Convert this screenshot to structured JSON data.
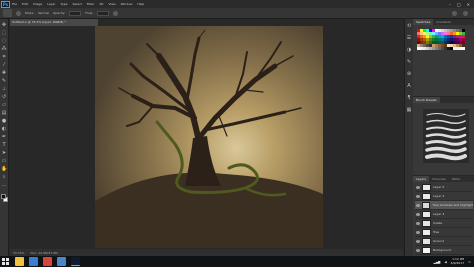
{
  "app": {
    "logo_text": "Ps",
    "menus": [
      "File",
      "Edit",
      "Image",
      "Layer",
      "Type",
      "Select",
      "Filter",
      "3D",
      "View",
      "Window",
      "Help"
    ],
    "window_controls": [
      "–",
      "□",
      "✕"
    ]
  },
  "options_bar": {
    "mode_label": "Mode:",
    "mode_value": "Normal",
    "opacity_label": "Opacity:",
    "opacity_value": "100%",
    "flow_label": "Flow:",
    "flow_value": "100%"
  },
  "document": {
    "tab_title": "Untitled-1 @ 33.3% (layer, RGB/8) *",
    "zoom": "33.33%",
    "doc_size": "Doc: 24.9M/47.8M"
  },
  "tools": [
    {
      "icon": "move-tool-icon",
      "glyph": "✥"
    },
    {
      "icon": "marquee-tool-icon",
      "glyph": "⬚"
    },
    {
      "icon": "lasso-tool-icon",
      "glyph": "◌"
    },
    {
      "icon": "quick-select-tool-icon",
      "glyph": "⁂"
    },
    {
      "icon": "crop-tool-icon",
      "glyph": "⌗"
    },
    {
      "icon": "eyedropper-tool-icon",
      "glyph": "⁄"
    },
    {
      "icon": "healing-tool-icon",
      "glyph": "✚"
    },
    {
      "icon": "brush-tool-icon",
      "glyph": "✎"
    },
    {
      "icon": "clone-stamp-tool-icon",
      "glyph": "⊥"
    },
    {
      "icon": "history-brush-tool-icon",
      "glyph": "↺"
    },
    {
      "icon": "eraser-tool-icon",
      "glyph": "▱"
    },
    {
      "icon": "gradient-tool-icon",
      "glyph": "▤"
    },
    {
      "icon": "blur-tool-icon",
      "glyph": "●"
    },
    {
      "icon": "dodge-tool-icon",
      "glyph": "◐"
    },
    {
      "icon": "pen-tool-icon",
      "glyph": "✒"
    },
    {
      "icon": "type-tool-icon",
      "glyph": "T"
    },
    {
      "icon": "path-select-tool-icon",
      "glyph": "➤"
    },
    {
      "icon": "shape-tool-icon",
      "glyph": "▭"
    },
    {
      "icon": "hand-tool-icon",
      "glyph": "✋"
    },
    {
      "icon": "zoom-tool-icon",
      "glyph": "⌕"
    },
    {
      "icon": "more-tools-icon",
      "glyph": "…"
    }
  ],
  "colors": {
    "foreground": "#121212",
    "background": "#ffffff",
    "accent": "#31a8ff"
  },
  "right_strip_icons": [
    {
      "icon": "history-panel-icon",
      "glyph": "⟲"
    },
    {
      "icon": "properties-panel-icon",
      "glyph": "☰"
    },
    {
      "icon": "adjustments-panel-icon",
      "glyph": "◑"
    },
    {
      "icon": "brush-settings-icon",
      "glyph": "✎"
    },
    {
      "icon": "clone-source-icon",
      "glyph": "⊕"
    },
    {
      "icon": "character-panel-icon",
      "glyph": "A"
    },
    {
      "icon": "paragraph-panel-icon",
      "glyph": "¶"
    },
    {
      "icon": "libraries-panel-icon",
      "glyph": "▦"
    }
  ],
  "panels": {
    "color_tabs": [
      "Swatches",
      "Gradients"
    ],
    "brush_panel_label": "Brush Presets",
    "layers_tabs": [
      "Layers",
      "Channels",
      "Paths"
    ]
  },
  "swatches": [
    "#ff0000",
    "#ffff00",
    "#00ff00",
    "#00ffff",
    "#0000ff",
    "#ff00ff",
    "#ffffff",
    "#ebebeb",
    "#d6d6d6",
    "#c2c2c2",
    "#adadad",
    "#999999",
    "#858585",
    "#707070",
    "#5c5c5c",
    "#000000",
    "#ff6f6f",
    "#ffc46f",
    "#fff36f",
    "#b8ff6f",
    "#6fffb0",
    "#6ff3ff",
    "#6fb5ff",
    "#7a6fff",
    "#c66fff",
    "#ff6fe0",
    "#ff6fa2",
    "#f26522",
    "#f7941d",
    "#fff200",
    "#8dc63f",
    "#39b54a",
    "#ed1c24",
    "#f26522",
    "#f7941d",
    "#fff200",
    "#8dc63f",
    "#39b54a",
    "#00a651",
    "#00a99d",
    "#00aeef",
    "#0072bc",
    "#0054a6",
    "#2e3192",
    "#662d91",
    "#92278f",
    "#ec008c",
    "#ed145b",
    "#9e0b0f",
    "#a0410d",
    "#a36209",
    "#aba000",
    "#598527",
    "#1a7b30",
    "#007236",
    "#00746b",
    "#0076a3",
    "#004b80",
    "#003471",
    "#1b1464",
    "#440e62",
    "#630460",
    "#9e005d",
    "#9e0039",
    "#790000",
    "#7b2e00",
    "#7d4900",
    "#827b00",
    "#406618",
    "#005e20",
    "#005826",
    "#005952",
    "#005b7f",
    "#003663",
    "#002157",
    "#0d004c",
    "#32004b",
    "#4b0049",
    "#7b0046",
    "#7a0026",
    "#c7b299",
    "#998675",
    "#736357",
    "#534741",
    "#37302d",
    "#c69c6d",
    "#a67c52",
    "#8c6239",
    "#754c24",
    "#603913",
    "#ffe3c6",
    "#f5d2a6",
    "#e3b58c",
    "#b8875c",
    "#8a5a34",
    "#4a2a16",
    "#ffffff",
    "#f2f2f2",
    "#e6e6e6",
    "#cccccc",
    "#b3b3b3",
    "#999999",
    "#808080",
    "#666666",
    "#4d4d4d",
    "#333333",
    "#1a1a1a",
    "#000000",
    "#fde6e6",
    "#e6f0fd",
    "#e6fde9",
    "#fdfbe6"
  ],
  "brushes": [
    {
      "width": 1
    },
    {
      "width": 1.5
    },
    {
      "width": 2
    },
    {
      "width": 2.5
    },
    {
      "width": 3
    },
    {
      "width": 3.5
    },
    {
      "width": 4
    }
  ],
  "layers": [
    {
      "name": "Layer 5",
      "selected": false,
      "thumb": "#e9e9e9"
    },
    {
      "name": "Layer 4",
      "selected": false,
      "thumb": "#e9e9e9"
    },
    {
      "name": "Tree shadows and highlights",
      "selected": true,
      "thumb": "#d8d8d8"
    },
    {
      "name": "Layer 3",
      "selected": false,
      "thumb": "#e9e9e9"
    },
    {
      "name": "Snake",
      "selected": false,
      "thumb": "#e4e4e4"
    },
    {
      "name": "Tree",
      "selected": false,
      "thumb": "#ededed"
    },
    {
      "name": "Ground",
      "selected": false,
      "thumb": "#e4e4e4"
    },
    {
      "name": "Background",
      "selected": false,
      "thumb": "#f5f5f5"
    }
  ],
  "taskbar": {
    "apps": [
      {
        "icon": "file-explorer-icon",
        "color": "#f3c340",
        "active": false
      },
      {
        "icon": "edge-browser-icon",
        "color": "#3a7fd0",
        "active": false
      },
      {
        "icon": "chrome-icon",
        "color": "#d8453a",
        "active": false
      },
      {
        "icon": "store-icon",
        "color": "#4a86c8",
        "active": false
      },
      {
        "icon": "photoshop-icon",
        "color": "#0d1a2f",
        "active": true
      }
    ],
    "time": "1:12 PM",
    "date": "6/9/2017"
  }
}
